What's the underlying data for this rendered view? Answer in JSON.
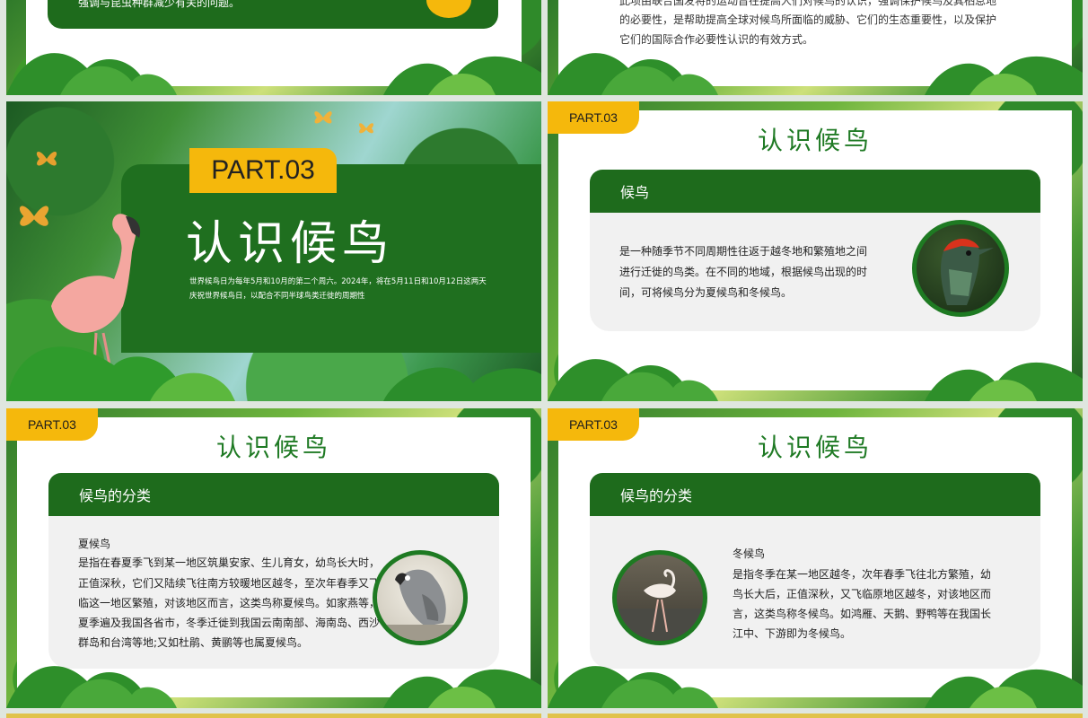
{
  "slide_tl": {
    "text": "强调与昆虫种群减少有关的问题。"
  },
  "slide_tr": {
    "lines": [
      "此项由联合国发将的运动旨在提高人们对候鸟的认识，强调保护候鸟及其栖息地",
      "的必要性，是帮助提高全球对候鸟所面临的威胁、它们的生态重要性，以及保护",
      "它们的国际合作必要性认识的有效方式。"
    ]
  },
  "slide_cover": {
    "part": "PART.03",
    "title": "认识候鸟",
    "desc_line1": "世界候鸟日为每年5月和10月的第二个周六。2024年，将在5月11日和10月12日这两天",
    "desc_line2": "庆祝世界候鸟日，以配合不同半球鸟类迁徙的周期性"
  },
  "slide_intro": {
    "part": "PART.03",
    "title": "认识候鸟",
    "panel_title": "候鸟",
    "lines": [
      "是一种随季节不同周期性往返于越冬地和繁殖地之间",
      "进行迁徙的鸟类。在不同的地域，根据候鸟出现的时",
      "间，可将候鸟分为夏候鸟和冬候鸟。"
    ]
  },
  "slide_summer": {
    "part": "PART.03",
    "title": "认识候鸟",
    "panel_title": "候鸟的分类",
    "subtitle": "夏候鸟",
    "lines": [
      "是指在春夏季飞到某一地区筑巢安家、生儿育女，幼鸟长大时，",
      "正值深秋，它们又陆续飞往南方较暖地区越冬，至次年春季又飞",
      "临这一地区繁殖，对该地区而言，这类鸟称夏候鸟。如家燕等，",
      "夏季遍及我国各省市，冬季迁徙到我国云南南部、海南岛、西沙",
      "群岛和台湾等地;又如杜鹃、黄鹂等也属夏候鸟。"
    ]
  },
  "slide_winter": {
    "part": "PART.03",
    "title": "认识候鸟",
    "panel_title": "候鸟的分类",
    "subtitle": "冬候鸟",
    "lines": [
      "是指冬季在某一地区越冬，次年春季飞往北方繁殖，幼",
      "鸟长大后，正值深秋，又飞临原地区越冬，对该地区而",
      "言，这类鸟称冬候鸟。如鸿雁、天鹅、野鸭等在我国长",
      "江中、下游即为冬候鸟。"
    ]
  },
  "colors": {
    "green_dark": "#1e6b1c",
    "green_title": "#1f7a24",
    "yellow": "#f5b80c"
  }
}
